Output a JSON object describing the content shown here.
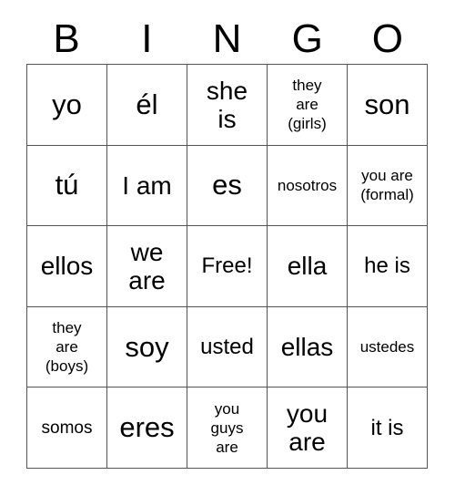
{
  "card": {
    "title": "BINGO",
    "header_letters": [
      "B",
      "I",
      "N",
      "G",
      "O"
    ],
    "border_color": "#555555",
    "background_color": "#ffffff",
    "text_color": "#000000",
    "columns": 5,
    "rows": 5,
    "free_space_label": "Free!",
    "rows_data": [
      [
        {
          "text": "yo",
          "size": "xl"
        },
        {
          "text": "él",
          "size": "xl"
        },
        {
          "text": "she\nis",
          "size": "lg"
        },
        {
          "text": "they\nare\n(girls)",
          "size": "xs"
        },
        {
          "text": "son",
          "size": "xl"
        }
      ],
      [
        {
          "text": "tú",
          "size": "xl"
        },
        {
          "text": "I am",
          "size": "lg"
        },
        {
          "text": "es",
          "size": "xl"
        },
        {
          "text": "nosotros",
          "size": "xs"
        },
        {
          "text": "you are\n(formal)",
          "size": "xs"
        }
      ],
      [
        {
          "text": "ellos",
          "size": "lg"
        },
        {
          "text": "we\nare",
          "size": "lg"
        },
        {
          "text": "Free!",
          "size": "md"
        },
        {
          "text": "ella",
          "size": "lg"
        },
        {
          "text": "he is",
          "size": "md"
        }
      ],
      [
        {
          "text": "they\nare\n(boys)",
          "size": "xs"
        },
        {
          "text": "soy",
          "size": "xl"
        },
        {
          "text": "usted",
          "size": "md"
        },
        {
          "text": "ellas",
          "size": "lg"
        },
        {
          "text": "ustedes",
          "size": "xs"
        }
      ],
      [
        {
          "text": "somos",
          "size": "sm"
        },
        {
          "text": "eres",
          "size": "xl"
        },
        {
          "text": "you\nguys\nare",
          "size": "xs"
        },
        {
          "text": "you\nare",
          "size": "lg"
        },
        {
          "text": "it is",
          "size": "md"
        }
      ]
    ]
  }
}
